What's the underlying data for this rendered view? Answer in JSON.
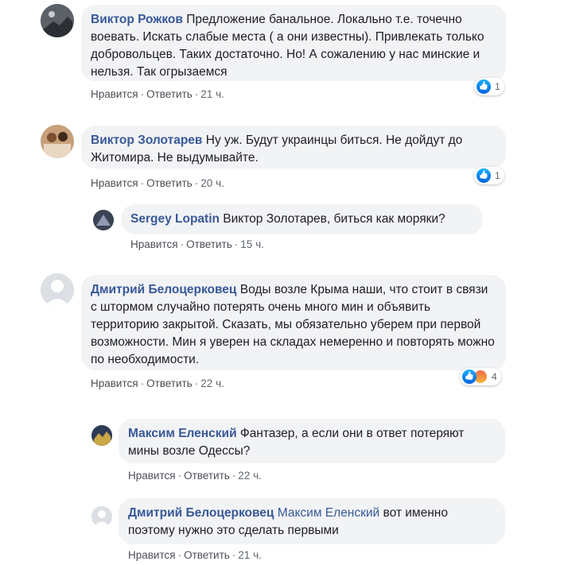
{
  "comments": [
    {
      "author": "Виктор Рожков",
      "text": "Предложение банальное. Локально т.е. точечно воевать. Искать слабые места ( а они известны). Привлекать только добровольцев. Таких достаточно. Но! А сожалению у нас минские и нельзя. Так огрызаемся",
      "like": "Нравится",
      "reply": "Ответить",
      "time": "21 ч.",
      "reactions": "1"
    },
    {
      "author": "Виктор Золотарев",
      "text": "Ну уж. Будут украинцы биться. Не дойдут до Житомира. Не выдумывайте.",
      "like": "Нравится",
      "reply": "Ответить",
      "time": "20 ч.",
      "reactions": "1"
    },
    {
      "author": "Sergey Lopatin",
      "text": "Виктор Золотарев, биться как моряки?",
      "like": "Нравится",
      "reply": "Ответить",
      "time": "15 ч."
    },
    {
      "author": "Дмитрий Белоцерковец",
      "text": "Воды возле Крыма наши, что стоит в связи с штормом случайно потерять очень много мин и объявить территорию закрытой. Сказать, мы обязательно уберем при первой возможности. Мин я уверен на складах немеренно и повторять можно по необходимости.",
      "like": "Нравится",
      "reply": "Ответить",
      "time": "22 ч.",
      "reactions": "4"
    },
    {
      "author": "Максим Еленский",
      "text": "Фантазер, а если они в ответ потеряют мины возле Одессы?",
      "like": "Нравится",
      "reply": "Ответить",
      "time": "22 ч."
    },
    {
      "author": "Дмитрий Белоцерковец",
      "mention": "Максим Еленский",
      "text": "вот именно поэтому нужно это сделать первыми",
      "like": "Нравится",
      "reply": "Ответить",
      "time": "21 ч."
    }
  ],
  "colors": {
    "link": "#385898",
    "bubble": "#f2f3f5",
    "like": "#1877f2"
  },
  "icons": [
    "like-icon",
    "angry-icon"
  ]
}
